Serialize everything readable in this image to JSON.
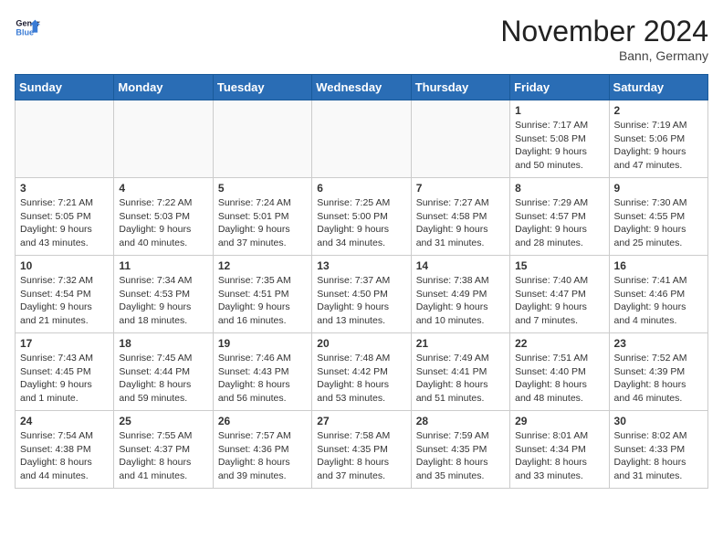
{
  "header": {
    "logo_line1": "General",
    "logo_line2": "Blue",
    "month_title": "November 2024",
    "location": "Bann, Germany"
  },
  "weekdays": [
    "Sunday",
    "Monday",
    "Tuesday",
    "Wednesday",
    "Thursday",
    "Friday",
    "Saturday"
  ],
  "weeks": [
    [
      {
        "day": "",
        "info": ""
      },
      {
        "day": "",
        "info": ""
      },
      {
        "day": "",
        "info": ""
      },
      {
        "day": "",
        "info": ""
      },
      {
        "day": "",
        "info": ""
      },
      {
        "day": "1",
        "info": "Sunrise: 7:17 AM\nSunset: 5:08 PM\nDaylight: 9 hours and 50 minutes."
      },
      {
        "day": "2",
        "info": "Sunrise: 7:19 AM\nSunset: 5:06 PM\nDaylight: 9 hours and 47 minutes."
      }
    ],
    [
      {
        "day": "3",
        "info": "Sunrise: 7:21 AM\nSunset: 5:05 PM\nDaylight: 9 hours and 43 minutes."
      },
      {
        "day": "4",
        "info": "Sunrise: 7:22 AM\nSunset: 5:03 PM\nDaylight: 9 hours and 40 minutes."
      },
      {
        "day": "5",
        "info": "Sunrise: 7:24 AM\nSunset: 5:01 PM\nDaylight: 9 hours and 37 minutes."
      },
      {
        "day": "6",
        "info": "Sunrise: 7:25 AM\nSunset: 5:00 PM\nDaylight: 9 hours and 34 minutes."
      },
      {
        "day": "7",
        "info": "Sunrise: 7:27 AM\nSunset: 4:58 PM\nDaylight: 9 hours and 31 minutes."
      },
      {
        "day": "8",
        "info": "Sunrise: 7:29 AM\nSunset: 4:57 PM\nDaylight: 9 hours and 28 minutes."
      },
      {
        "day": "9",
        "info": "Sunrise: 7:30 AM\nSunset: 4:55 PM\nDaylight: 9 hours and 25 minutes."
      }
    ],
    [
      {
        "day": "10",
        "info": "Sunrise: 7:32 AM\nSunset: 4:54 PM\nDaylight: 9 hours and 21 minutes."
      },
      {
        "day": "11",
        "info": "Sunrise: 7:34 AM\nSunset: 4:53 PM\nDaylight: 9 hours and 18 minutes."
      },
      {
        "day": "12",
        "info": "Sunrise: 7:35 AM\nSunset: 4:51 PM\nDaylight: 9 hours and 16 minutes."
      },
      {
        "day": "13",
        "info": "Sunrise: 7:37 AM\nSunset: 4:50 PM\nDaylight: 9 hours and 13 minutes."
      },
      {
        "day": "14",
        "info": "Sunrise: 7:38 AM\nSunset: 4:49 PM\nDaylight: 9 hours and 10 minutes."
      },
      {
        "day": "15",
        "info": "Sunrise: 7:40 AM\nSunset: 4:47 PM\nDaylight: 9 hours and 7 minutes."
      },
      {
        "day": "16",
        "info": "Sunrise: 7:41 AM\nSunset: 4:46 PM\nDaylight: 9 hours and 4 minutes."
      }
    ],
    [
      {
        "day": "17",
        "info": "Sunrise: 7:43 AM\nSunset: 4:45 PM\nDaylight: 9 hours and 1 minute."
      },
      {
        "day": "18",
        "info": "Sunrise: 7:45 AM\nSunset: 4:44 PM\nDaylight: 8 hours and 59 minutes."
      },
      {
        "day": "19",
        "info": "Sunrise: 7:46 AM\nSunset: 4:43 PM\nDaylight: 8 hours and 56 minutes."
      },
      {
        "day": "20",
        "info": "Sunrise: 7:48 AM\nSunset: 4:42 PM\nDaylight: 8 hours and 53 minutes."
      },
      {
        "day": "21",
        "info": "Sunrise: 7:49 AM\nSunset: 4:41 PM\nDaylight: 8 hours and 51 minutes."
      },
      {
        "day": "22",
        "info": "Sunrise: 7:51 AM\nSunset: 4:40 PM\nDaylight: 8 hours and 48 minutes."
      },
      {
        "day": "23",
        "info": "Sunrise: 7:52 AM\nSunset: 4:39 PM\nDaylight: 8 hours and 46 minutes."
      }
    ],
    [
      {
        "day": "24",
        "info": "Sunrise: 7:54 AM\nSunset: 4:38 PM\nDaylight: 8 hours and 44 minutes."
      },
      {
        "day": "25",
        "info": "Sunrise: 7:55 AM\nSunset: 4:37 PM\nDaylight: 8 hours and 41 minutes."
      },
      {
        "day": "26",
        "info": "Sunrise: 7:57 AM\nSunset: 4:36 PM\nDaylight: 8 hours and 39 minutes."
      },
      {
        "day": "27",
        "info": "Sunrise: 7:58 AM\nSunset: 4:35 PM\nDaylight: 8 hours and 37 minutes."
      },
      {
        "day": "28",
        "info": "Sunrise: 7:59 AM\nSunset: 4:35 PM\nDaylight: 8 hours and 35 minutes."
      },
      {
        "day": "29",
        "info": "Sunrise: 8:01 AM\nSunset: 4:34 PM\nDaylight: 8 hours and 33 minutes."
      },
      {
        "day": "30",
        "info": "Sunrise: 8:02 AM\nSunset: 4:33 PM\nDaylight: 8 hours and 31 minutes."
      }
    ]
  ]
}
